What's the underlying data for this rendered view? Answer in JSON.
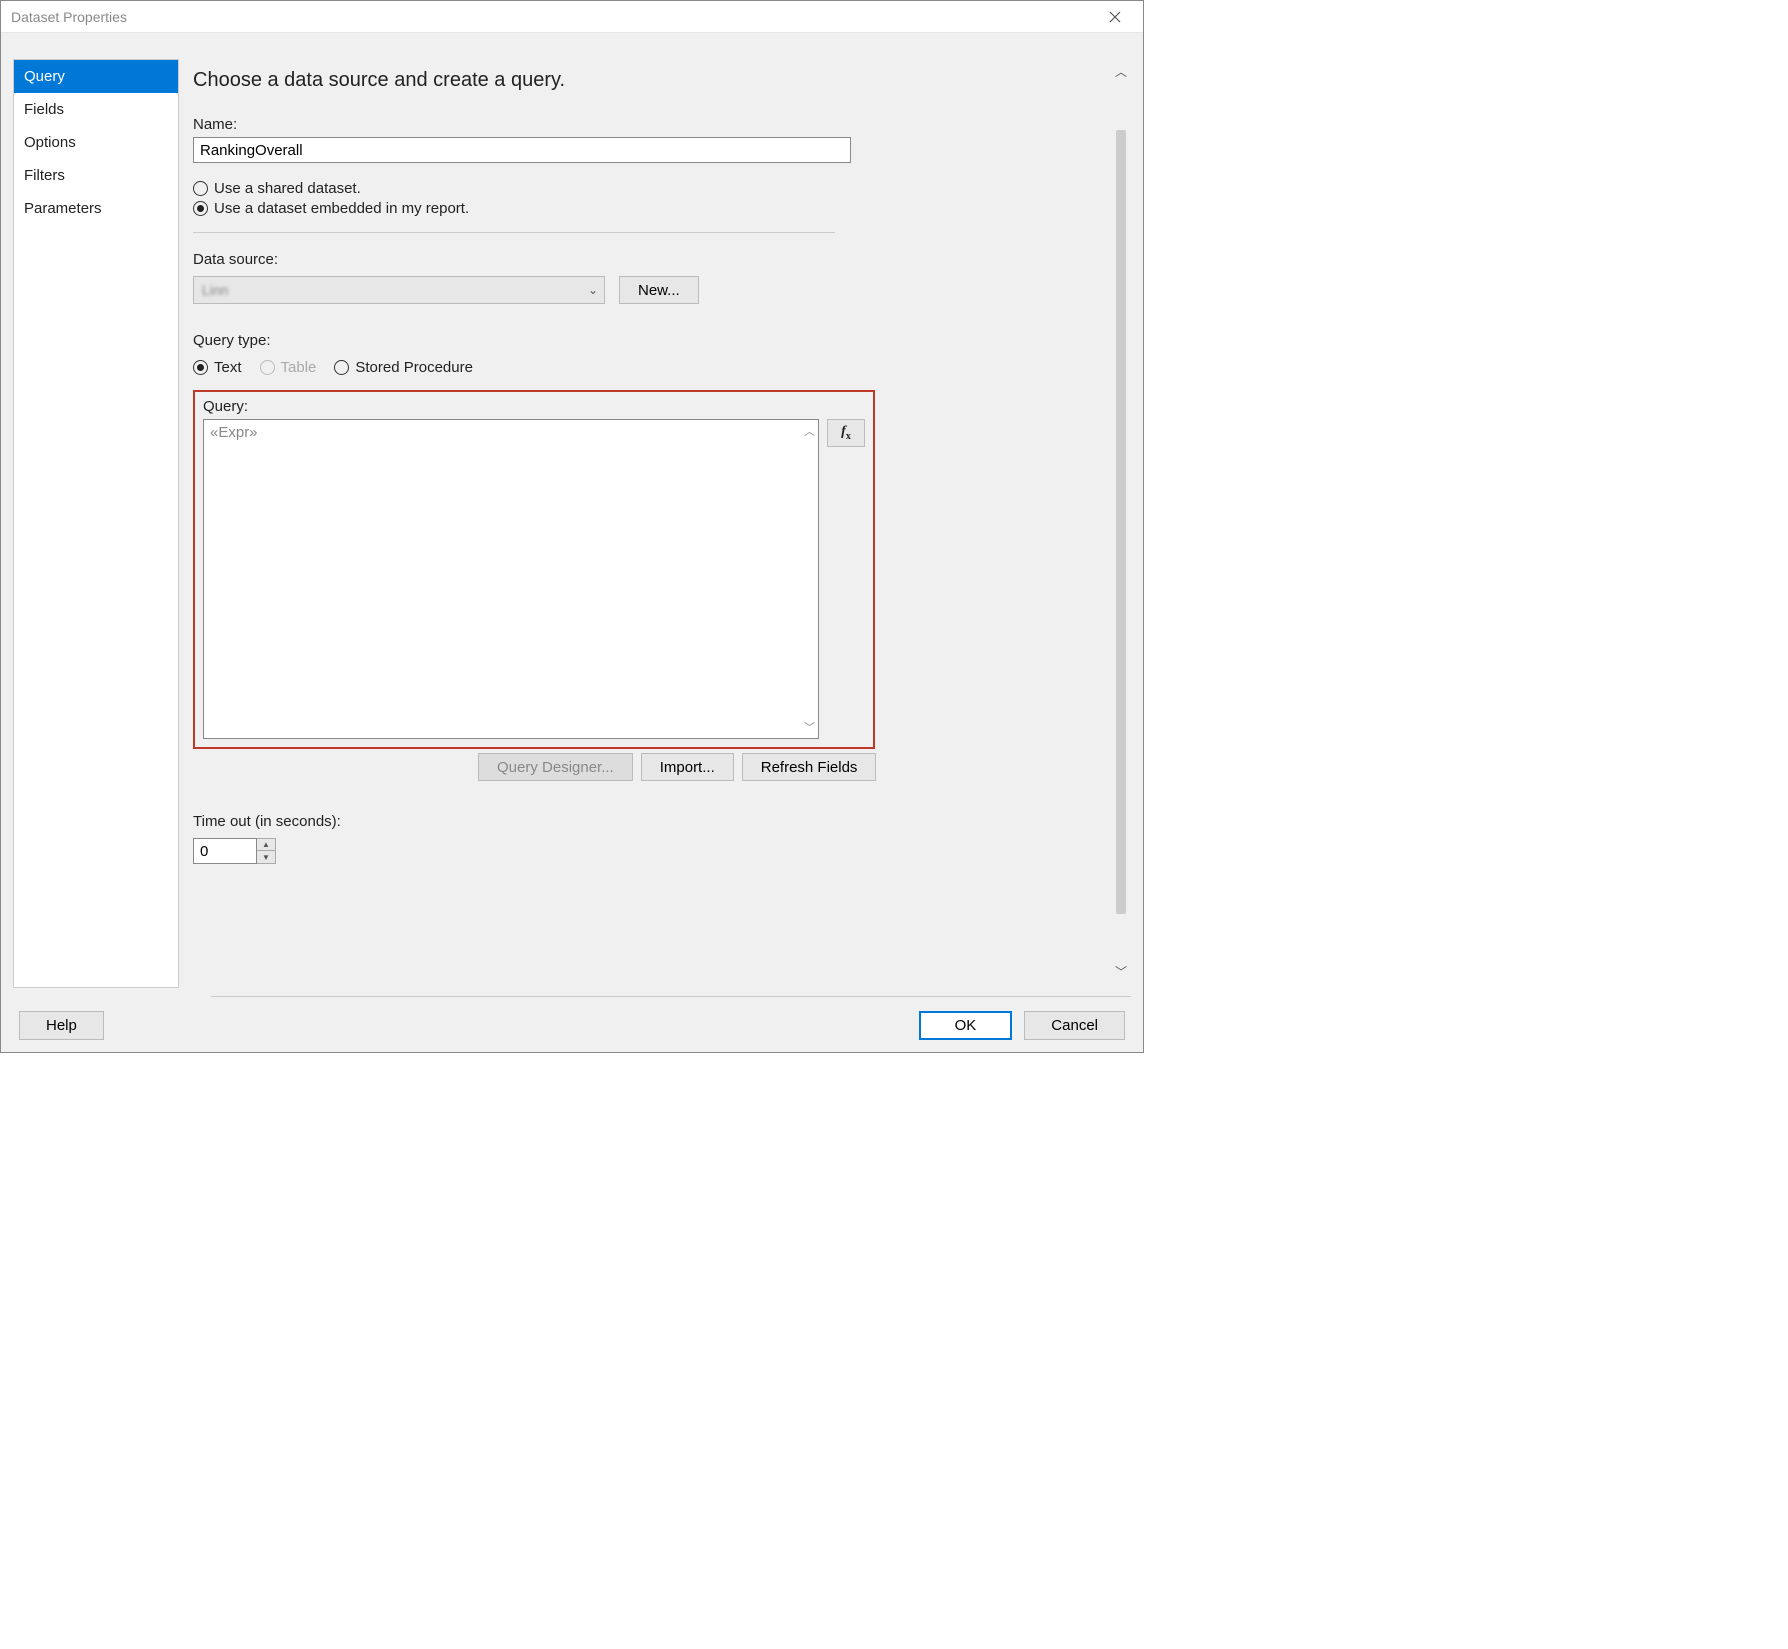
{
  "window": {
    "title": "Dataset Properties"
  },
  "sidebar": {
    "items": [
      {
        "label": "Query",
        "selected": true
      },
      {
        "label": "Fields"
      },
      {
        "label": "Options"
      },
      {
        "label": "Filters"
      },
      {
        "label": "Parameters"
      }
    ]
  },
  "content": {
    "heading": "Choose a data source and create a query.",
    "name_label": "Name:",
    "name_value": "RankingOverall",
    "dataset_radios": {
      "shared": "Use a shared dataset.",
      "embedded": "Use a dataset embedded in my report."
    },
    "datasource_label": "Data source:",
    "datasource_value": "Linn",
    "new_button": "New...",
    "query_type_label": "Query type:",
    "query_types": {
      "text": "Text",
      "table": "Table",
      "sp": "Stored Procedure"
    },
    "query_label": "Query:",
    "query_value": "«Expr»",
    "buttons": {
      "query_designer": "Query Designer...",
      "import": "Import...",
      "refresh_fields": "Refresh Fields"
    },
    "timeout_label": "Time out (in seconds):",
    "timeout_value": "0"
  },
  "footer": {
    "help": "Help",
    "ok": "OK",
    "cancel": "Cancel"
  }
}
